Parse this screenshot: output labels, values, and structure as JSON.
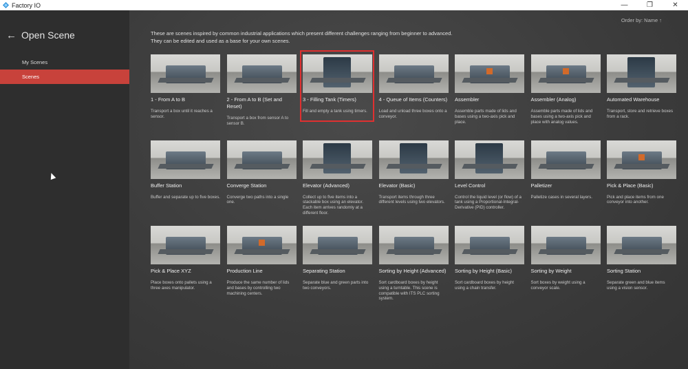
{
  "window": {
    "title": "Factory IO",
    "controls": [
      "—",
      "❐",
      "✕"
    ]
  },
  "sidebar": {
    "back_glyph": "←",
    "title": "Open Scene",
    "items": [
      {
        "label": "My Scenes",
        "active": false
      },
      {
        "label": "Scenes",
        "active": true
      }
    ]
  },
  "main": {
    "order_by": "Order by: Name ↑",
    "intro_line1": "These are scenes inspired by common industrial applications which present different challenges ranging from beginner to advanced.",
    "intro_line2": "They can  be edited and used as a base for your own scenes.",
    "scenes": [
      {
        "title": "1 - From A to B",
        "desc": "Transport a box until it reaches a sensor."
      },
      {
        "title": "2 - From A to B (Set and Reset)",
        "desc": "Transport a box from sensor A to sensor B."
      },
      {
        "title": "3 - Filling Tank (Timers)",
        "desc": "Fill and empty a tank using timers."
      },
      {
        "title": "4 - Queue of Items (Counters)",
        "desc": "Load and unload three boxes onto a conveyor."
      },
      {
        "title": "Assembler",
        "desc": "Assemble parts made of lids and bases using a two-axis pick and place."
      },
      {
        "title": "Assembler (Analog)",
        "desc": "Assemble parts made of lids and bases using a two-axis pick and place with analog values."
      },
      {
        "title": "Automated Warehouse",
        "desc": "Transport, store and retrieve boxes from a rack."
      },
      {
        "title": "Buffer Station",
        "desc": "Buffer and separate up to five boxes."
      },
      {
        "title": "Converge Station",
        "desc": "Converge two paths into a single one."
      },
      {
        "title": "Elevator (Advanced)",
        "desc": "Collect up to five items into a stackable box using an elevator. Each item arrives randomly at a different floor."
      },
      {
        "title": "Elevator (Basic)",
        "desc": "Transport items through three different levels using two elevators."
      },
      {
        "title": "Level Control",
        "desc": "Control the liquid level (or flow) of a tank using a Proportional-Integral-Derivative (PID) controller."
      },
      {
        "title": "Palletizer",
        "desc": "Palletize cases in several layers."
      },
      {
        "title": "Pick & Place (Basic)",
        "desc": "Pick and place items from one conveyor into another."
      },
      {
        "title": "Pick & Place XYZ",
        "desc": "Place boxes onto pallets using a three axes manipulator."
      },
      {
        "title": "Production Line",
        "desc": "Produce the same number of lids and bases by controlling two machining centers."
      },
      {
        "title": "Separating Station",
        "desc": "Separate blue and green parts into two conveyors."
      },
      {
        "title": "Sorting by Height (Advanced)",
        "desc": "Sort cardboard boxes by height using a turntable. This scene is compatible with ITS PLC sorting system."
      },
      {
        "title": "Sorting by Height (Basic)",
        "desc": "Sort cardboard boxes by height using a chain transfer."
      },
      {
        "title": "Sorting by Weight",
        "desc": "Sort boxes by weight using a conveyor scale."
      },
      {
        "title": "Sorting Station",
        "desc": "Separate green and blue items using a vision sensor."
      }
    ]
  },
  "colors": {
    "accent": "#c8423b",
    "highlight": "#e03030",
    "sidebar_bg": "#2e2e2e"
  }
}
